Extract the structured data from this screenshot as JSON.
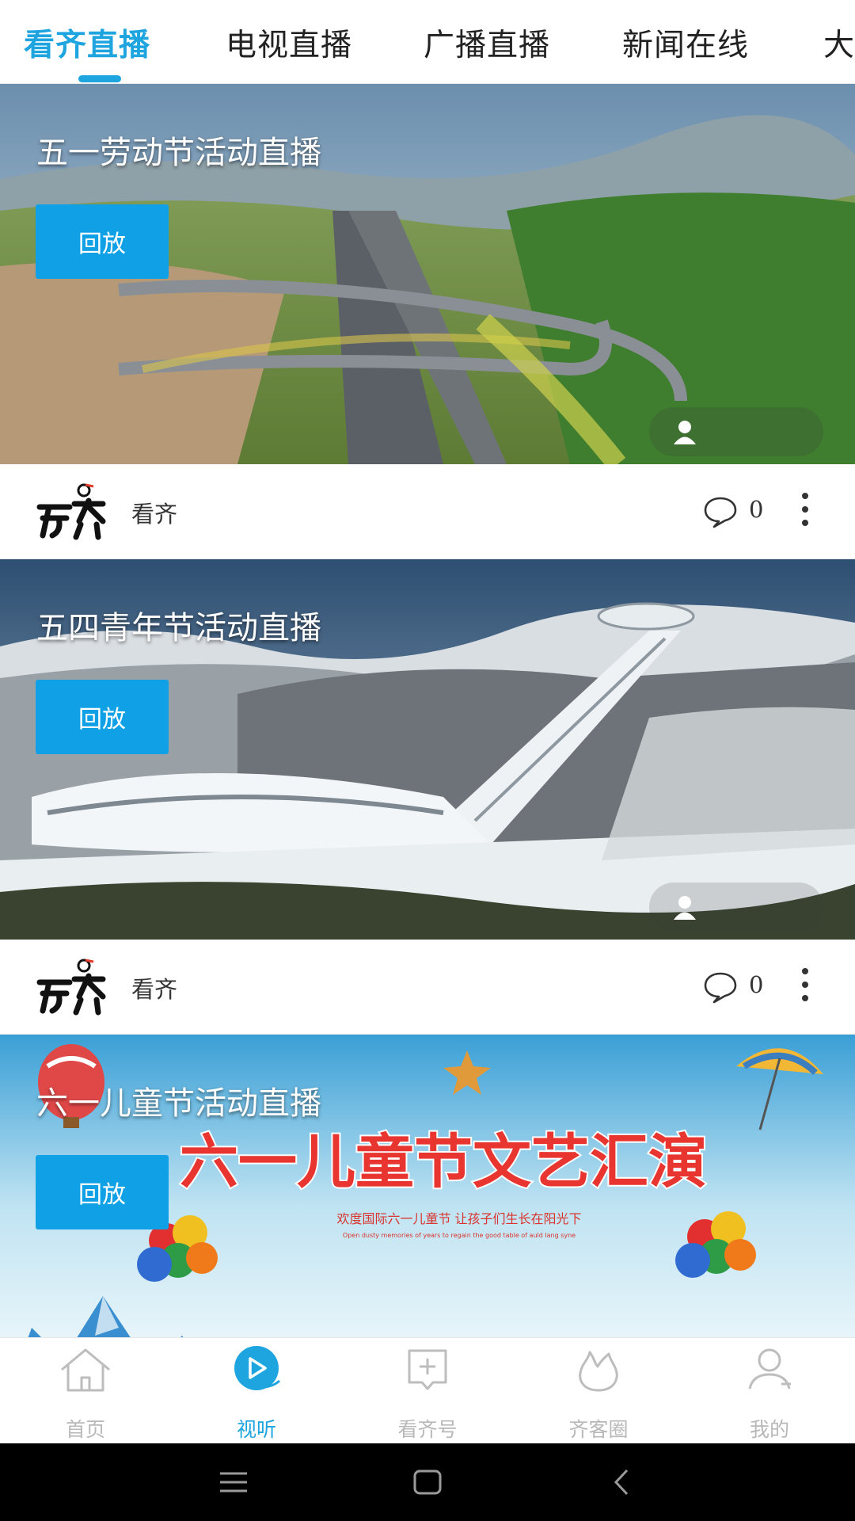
{
  "tabs": [
    {
      "label": "看齐直播",
      "active": true
    },
    {
      "label": "电视直播",
      "active": false
    },
    {
      "label": "广播直播",
      "active": false
    },
    {
      "label": "新闻在线",
      "active": false
    },
    {
      "label": "大",
      "active": false
    }
  ],
  "cards": [
    {
      "title": "五一劳动节活动直播",
      "button": "回放",
      "author": "看齐",
      "comments": "0",
      "scene": "highway-valley"
    },
    {
      "title": "五四青年节活动直播",
      "button": "回放",
      "author": "看齐",
      "comments": "0",
      "scene": "ski-jump-snow"
    },
    {
      "title": "六一儿童节活动直播",
      "button": "回放",
      "scene": "childrens-day-poster",
      "poster": {
        "headline": "六一儿童节文艺汇演",
        "subline": "欢度国际六一儿童节 让孩子们生长在阳光下",
        "subline_en": "Open dusty memories of years to regain the good table of auld lang syne"
      }
    }
  ],
  "bottom_nav": [
    {
      "label": "首页",
      "icon": "home-icon",
      "active": false
    },
    {
      "label": "视听",
      "icon": "play-icon",
      "active": true
    },
    {
      "label": "看齐号",
      "icon": "add-box-icon",
      "active": false
    },
    {
      "label": "齐客圈",
      "icon": "flame-icon",
      "active": false
    },
    {
      "label": "我的",
      "icon": "person-icon",
      "active": false
    }
  ],
  "system_nav": [
    "menu-icon",
    "home-square-icon",
    "back-icon"
  ],
  "colors": {
    "accent": "#1ea5e0",
    "replay_button": "#0fa0e6",
    "inactive": "#b8b8b8"
  }
}
